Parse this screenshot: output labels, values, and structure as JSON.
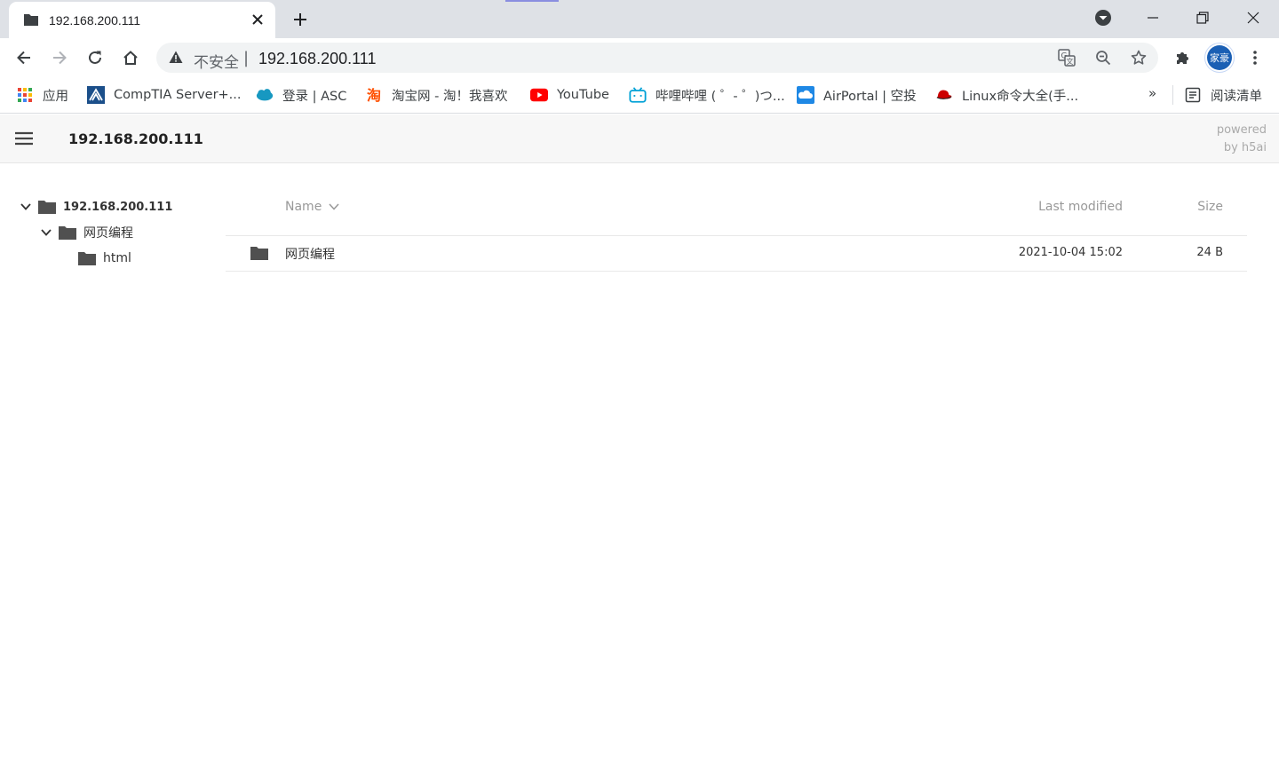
{
  "browser": {
    "tab": {
      "title": "192.168.200.111"
    },
    "omnibox": {
      "security_label": "不安全",
      "separator": "|",
      "url": "192.168.200.111"
    },
    "profile": {
      "avatar_text": "家豪"
    },
    "bookmarks": [
      {
        "label": "应用",
        "icon": "apps-grid-icon"
      },
      {
        "label": "CompTIA Server+...",
        "icon": "comptia-icon"
      },
      {
        "label": "登录 | ASC",
        "icon": "salesforce-cloud-icon"
      },
      {
        "label": "淘宝网 - 淘！我喜欢",
        "icon": "taobao-icon"
      },
      {
        "label": "YouTube",
        "icon": "youtube-icon"
      },
      {
        "label": "哔哩哔哩 ( ゜- ゜)つ...",
        "icon": "bilibili-icon"
      },
      {
        "label": "AirPortal | 空投",
        "icon": "airportal-icon"
      },
      {
        "label": "Linux命令大全(手...",
        "icon": "redhat-icon"
      }
    ],
    "more_bookmarks": "»",
    "reading_list": "阅读清单"
  },
  "h5ai": {
    "title": "192.168.200.111",
    "powered_line1": "powered",
    "powered_line2": "by h5ai",
    "tree": [
      {
        "label": "192.168.200.111",
        "expanded": true,
        "bold": true
      },
      {
        "label": "网页编程",
        "expanded": true,
        "bold": false
      },
      {
        "label": "html",
        "expanded": false,
        "bold": false
      }
    ],
    "columns": {
      "name": "Name",
      "modified": "Last modified",
      "size": "Size"
    },
    "items": [
      {
        "name": "网页编程",
        "modified": "2021-10-04 15:02",
        "size": "24 B",
        "type": "folder"
      }
    ]
  },
  "colors": {
    "tabstrip": "#dee1e6",
    "omnibox": "#f1f3f4",
    "h5_header": "#f7f7f7",
    "folder": "#505050",
    "avatar": "#1a5fb4"
  }
}
